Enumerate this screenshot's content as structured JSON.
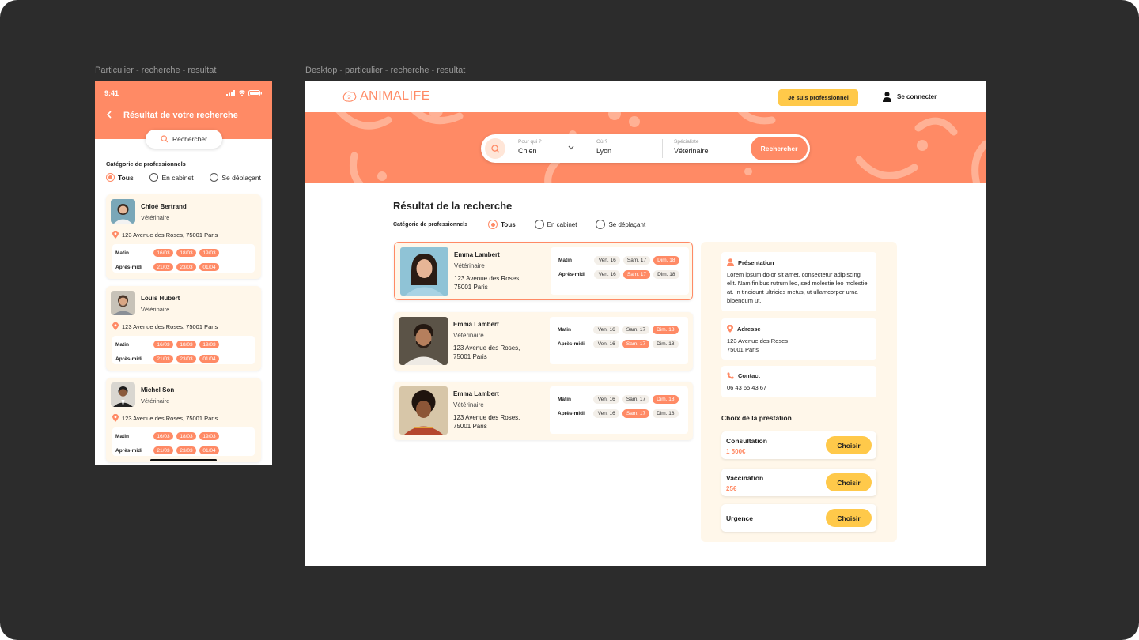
{
  "frames": {
    "mobile_label": "Particulier - recherche - resultat",
    "desktop_label": "Desktop - particulier - recherche - resultat"
  },
  "colors": {
    "primary": "#ff8a65",
    "accent": "#ffc94a",
    "card_bg": "#fff7ea"
  },
  "mobile": {
    "status_time": "9:41",
    "title": "Résultat de votre recherche",
    "search_label": "Rechercher",
    "category_label": "Catégorie de professionnels",
    "filters": [
      "Tous",
      "En cabinet",
      "Se déplaçant"
    ],
    "selected_filter": "Tous",
    "slot_labels": {
      "morning": "Matin",
      "afternoon": "Après-midi"
    },
    "cards": [
      {
        "name": "Chloé Bertrand",
        "role": "Vétérinaire",
        "address": "123 Avenue des Roses, 75001 Paris",
        "morning": [
          "16/03",
          "18/03",
          "19/03"
        ],
        "afternoon": [
          "21/02",
          "23/03",
          "01/04"
        ]
      },
      {
        "name": "Louis Hubert",
        "role": "Vétérinaire",
        "address": "123 Avenue des Roses, 75001 Paris",
        "morning": [
          "16/03",
          "18/03",
          "19/03"
        ],
        "afternoon": [
          "21/03",
          "23/03",
          "01/04"
        ]
      },
      {
        "name": "Michel Son",
        "role": "Vétérinaire",
        "address": "123 Avenue des Roses, 75001 Paris",
        "morning": [
          "16/03",
          "18/03",
          "19/03"
        ],
        "afternoon": [
          "21/03",
          "23/03",
          "01/04"
        ]
      }
    ]
  },
  "desktop": {
    "logo": "ANIMALIFE",
    "pro_button": "Je suis professionnel",
    "login": "Se connecter",
    "search": {
      "who_label": "Pour qui ?",
      "who_value": "Chien",
      "where_label": "Où ?",
      "where_value": "Lyon",
      "specialist_label": "Spécialiste",
      "specialist_value": "Vétérinaire",
      "submit": "Rechercher"
    },
    "results_title": "Résultat de la recherche",
    "category_label": "Catégorie de professionnels",
    "filters": [
      "Tous",
      "En cabinet",
      "Se déplaçant"
    ],
    "selected_filter": "Tous",
    "slot_labels": {
      "morning": "Matin",
      "afternoon": "Après-midi"
    },
    "days": [
      "Ven. 16",
      "Sam. 17",
      "Dim. 18"
    ],
    "cards": [
      {
        "name": "Emma Lambert",
        "role": "Vétérinaire",
        "address": "123 Avenue des Roses, 75001 Paris",
        "morning_available": "Dim. 18",
        "afternoon_available": "Sam. 17",
        "selected": true
      },
      {
        "name": "Emma Lambert",
        "role": "Vétérinaire",
        "address": "123 Avenue des Roses, 75001 Paris",
        "morning_available": "Dim. 18",
        "afternoon_available": "Sam. 17",
        "selected": false
      },
      {
        "name": "Emma Lambert",
        "role": "Vétérinaire",
        "address": "123 Avenue des Roses, 75001 Paris",
        "morning_available": "Dim. 18",
        "afternoon_available": "Sam. 17",
        "selected": false
      }
    ],
    "detail": {
      "presentation_title": "Présentation",
      "presentation_text": "Lorem ipsum dolor sit amet, consectetur adipiscing elit. Nam finibus rutrum leo, sed molestie leo molestie at. In tincidunt ultricies metus, ut ullamcorper urna bibendum ut.",
      "address_title": "Adresse",
      "address_line1": "123 Avenue des Roses",
      "address_line2": "75001 Paris",
      "contact_title": "Contact",
      "phone": "06 43 65 43 67",
      "services_title": "Choix de la prestation",
      "choose_label": "Choisir",
      "services": [
        {
          "name": "Consultation",
          "price": "1 500€"
        },
        {
          "name": "Vaccination",
          "price": "25€"
        },
        {
          "name": "Urgence",
          "price": ""
        }
      ]
    }
  }
}
